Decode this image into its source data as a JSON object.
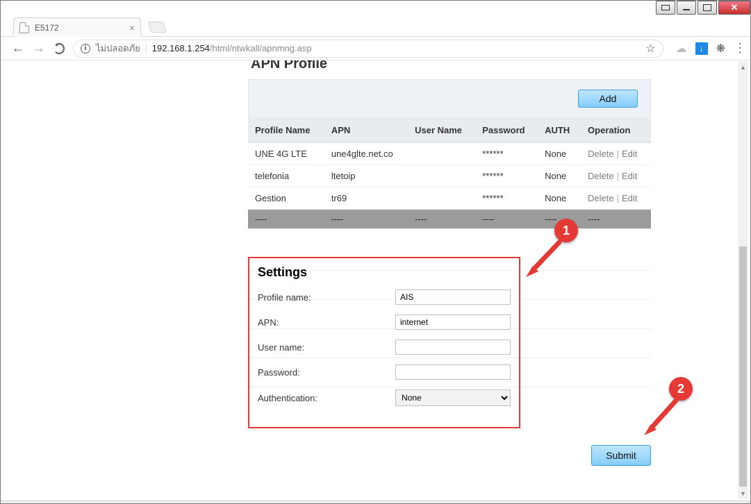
{
  "os": {
    "smallWindowTip": "ลดลง"
  },
  "browser": {
    "tab_title": "E5172",
    "not_secure": "ไม่ปลอดภัย",
    "url_host": "192.168.1.254",
    "url_path": "/html/ntwkall/apnmng.asp"
  },
  "page": {
    "title": "APN Profile",
    "add_btn": "Add",
    "columns": {
      "profile": "Profile Name",
      "apn": "APN",
      "user": "User Name",
      "pass": "Password",
      "auth": "AUTH",
      "op": "Operation"
    },
    "rows": [
      {
        "profile": "UNE 4G LTE",
        "apn": "une4glte.net.co",
        "user": "",
        "pass": "******",
        "auth": "None"
      },
      {
        "profile": "telefonia",
        "apn": "ltetoip",
        "user": "",
        "pass": "******",
        "auth": "None"
      },
      {
        "profile": "Gestion",
        "apn": "tr69",
        "user": "",
        "pass": "******",
        "auth": "None"
      }
    ],
    "op_delete": "Delete",
    "op_edit": "Edit",
    "dash": "----",
    "settings": {
      "title": "Settings",
      "profile_label": "Profile name:",
      "profile_value": "AIS",
      "apn_label": "APN:",
      "apn_value": "internet",
      "user_label": "User name:",
      "user_value": "",
      "pass_label": "Password:",
      "pass_value": "",
      "auth_label": "Authentication:",
      "auth_value": "None"
    },
    "submit": "Submit"
  },
  "callouts": {
    "one": "1",
    "two": "2"
  }
}
